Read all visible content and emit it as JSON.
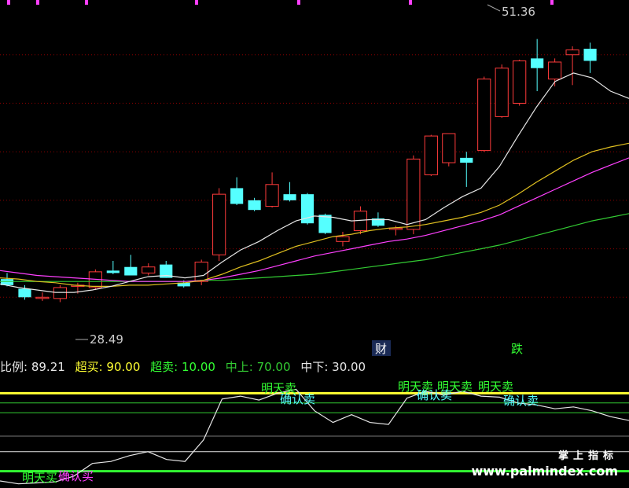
{
  "chart_data": {
    "type": "candlestick",
    "price_range": [
      26,
      54
    ],
    "annotations": {
      "high": "51.36",
      "low": "28.49",
      "marker_cai": "财",
      "marker_die": "跌"
    },
    "candles": [
      {
        "o": 31.5,
        "h": 32.0,
        "l": 30.9,
        "c": 31.0
      },
      {
        "o": 30.7,
        "h": 31.0,
        "l": 29.8,
        "c": 30.0
      },
      {
        "o": 30.0,
        "h": 30.4,
        "l": 29.7,
        "c": 30.0
      },
      {
        "o": 29.9,
        "h": 31.0,
        "l": 29.6,
        "c": 30.8
      },
      {
        "o": 30.9,
        "h": 31.2,
        "l": 30.3,
        "c": 31.0
      },
      {
        "o": 30.8,
        "h": 32.3,
        "l": 30.6,
        "c": 32.1
      },
      {
        "o": 32.2,
        "h": 33.0,
        "l": 31.9,
        "c": 32.0
      },
      {
        "o": 32.5,
        "h": 33.5,
        "l": 31.8,
        "c": 31.8
      },
      {
        "o": 32.0,
        "h": 32.8,
        "l": 31.8,
        "c": 32.5
      },
      {
        "o": 32.7,
        "h": 33.0,
        "l": 31.6,
        "c": 31.6
      },
      {
        "o": 31.2,
        "h": 31.4,
        "l": 30.8,
        "c": 30.9
      },
      {
        "o": 31.3,
        "h": 33.1,
        "l": 31.0,
        "c": 32.9
      },
      {
        "o": 33.5,
        "h": 39.0,
        "l": 33.0,
        "c": 38.5
      },
      {
        "o": 39.0,
        "h": 39.9,
        "l": 37.6,
        "c": 37.7
      },
      {
        "o": 38.0,
        "h": 38.2,
        "l": 37.1,
        "c": 37.2
      },
      {
        "o": 37.5,
        "h": 40.3,
        "l": 37.4,
        "c": 39.3
      },
      {
        "o": 38.5,
        "h": 39.5,
        "l": 37.9,
        "c": 38.0
      },
      {
        "o": 38.5,
        "h": 38.6,
        "l": 36.0,
        "c": 36.1
      },
      {
        "o": 36.8,
        "h": 36.9,
        "l": 35.2,
        "c": 35.3
      },
      {
        "o": 34.6,
        "h": 35.4,
        "l": 34.2,
        "c": 35.0
      },
      {
        "o": 35.5,
        "h": 37.5,
        "l": 35.2,
        "c": 37.1
      },
      {
        "o": 36.5,
        "h": 37.0,
        "l": 35.8,
        "c": 35.9
      },
      {
        "o": 35.6,
        "h": 35.9,
        "l": 35.1,
        "c": 35.7
      },
      {
        "o": 35.6,
        "h": 41.7,
        "l": 35.2,
        "c": 41.4
      },
      {
        "o": 40.1,
        "h": 43.4,
        "l": 40.0,
        "c": 43.3
      },
      {
        "o": 41.1,
        "h": 43.4,
        "l": 40.8,
        "c": 43.5
      },
      {
        "o": 41.5,
        "h": 42.0,
        "l": 39.1,
        "c": 41.1
      },
      {
        "o": 42.1,
        "h": 48.2,
        "l": 42.0,
        "c": 48.0
      },
      {
        "o": 44.9,
        "h": 49.2,
        "l": 44.8,
        "c": 48.9
      },
      {
        "o": 46.0,
        "h": 49.6,
        "l": 45.8,
        "c": 49.5
      },
      {
        "o": 49.7,
        "h": 51.3,
        "l": 47.0,
        "c": 48.9
      },
      {
        "o": 48.0,
        "h": 49.7,
        "l": 47.4,
        "c": 49.4
      },
      {
        "o": 50.0,
        "h": 50.7,
        "l": 47.5,
        "c": 50.4
      },
      {
        "o": 50.5,
        "h": 51.0,
        "l": 48.5,
        "c": 49.5
      }
    ],
    "ma_white": [
      31.1,
      30.8,
      30.6,
      30.4,
      30.4,
      30.6,
      30.9,
      31.3,
      31.7,
      31.8,
      31.6,
      31.8,
      32.9,
      33.9,
      34.6,
      35.5,
      36.3,
      36.7,
      36.6,
      36.3,
      36.4,
      36.4,
      36.0,
      36.4,
      37.4,
      38.3,
      39.0,
      40.8,
      43.3,
      45.7,
      47.8,
      48.5,
      48.1,
      47.0,
      46.4
    ],
    "ma_yellow": [
      31.6,
      31.5,
      31.3,
      31.2,
      31.0,
      30.9,
      30.9,
      31.0,
      31.0,
      31.1,
      31.2,
      31.4,
      31.9,
      32.5,
      33.0,
      33.6,
      34.2,
      34.6,
      35.0,
      35.2,
      35.5,
      35.7,
      35.8,
      36.0,
      36.3,
      36.6,
      37.0,
      37.6,
      38.5,
      39.5,
      40.4,
      41.3,
      42.0,
      42.4,
      42.7
    ],
    "ma_magenta": [
      32.2,
      32.0,
      31.8,
      31.7,
      31.6,
      31.5,
      31.4,
      31.3,
      31.3,
      31.3,
      31.3,
      31.4,
      31.6,
      31.9,
      32.2,
      32.6,
      33.0,
      33.4,
      33.7,
      34.0,
      34.3,
      34.6,
      34.8,
      35.1,
      35.5,
      35.9,
      36.3,
      36.8,
      37.5,
      38.2,
      38.9,
      39.6,
      40.3,
      40.9,
      41.5
    ],
    "ma_green": [
      31.3,
      31.3,
      31.3,
      31.3,
      31.3,
      31.3,
      31.3,
      31.3,
      31.3,
      31.3,
      31.3,
      31.4,
      31.4,
      31.5,
      31.6,
      31.7,
      31.8,
      31.9,
      32.1,
      32.3,
      32.5,
      32.7,
      32.9,
      33.1,
      33.4,
      33.7,
      34.0,
      34.3,
      34.7,
      35.1,
      35.5,
      35.9,
      36.3,
      36.6,
      36.9
    ],
    "osc_values": [
      0,
      -3,
      -2,
      -1,
      5,
      18,
      20,
      26,
      30,
      22,
      20,
      42,
      84,
      87,
      83,
      90,
      94,
      72,
      60,
      68,
      60,
      58,
      85,
      92,
      88,
      92,
      87,
      86,
      80,
      78,
      74,
      76,
      72,
      66,
      62
    ],
    "osc_range": [
      0,
      100
    ]
  },
  "legend": {
    "ratio_label": "比例:",
    "ratio_value": "89.21",
    "overbuy_label": "超买:",
    "overbuy_value": "90.00",
    "oversell_label": "超卖:",
    "oversell_value": "10.00",
    "midup_label": "中上:",
    "midup_value": "70.00",
    "middown_label": "中下:",
    "middown_value": "30.00"
  },
  "signals": {
    "sell_tomorrow": "明天卖",
    "confirm_sell": "确认卖",
    "buy_tomorrow": "明天买",
    "confirm_buy": "确认买"
  },
  "watermark": {
    "cn": "掌上指标",
    "url": "www.palmindex.com"
  },
  "colors": {
    "up": "#ff3b3b",
    "down": "#55ffff",
    "grid": "#8b0000",
    "ma_white": "#e6e6e6",
    "ma_yellow": "#e0c020",
    "ma_magenta": "#ff40ff",
    "ma_green": "#33cc33",
    "overbuy": "#ffff33",
    "oversell": "#33ff33",
    "midline": "#33cc33"
  }
}
